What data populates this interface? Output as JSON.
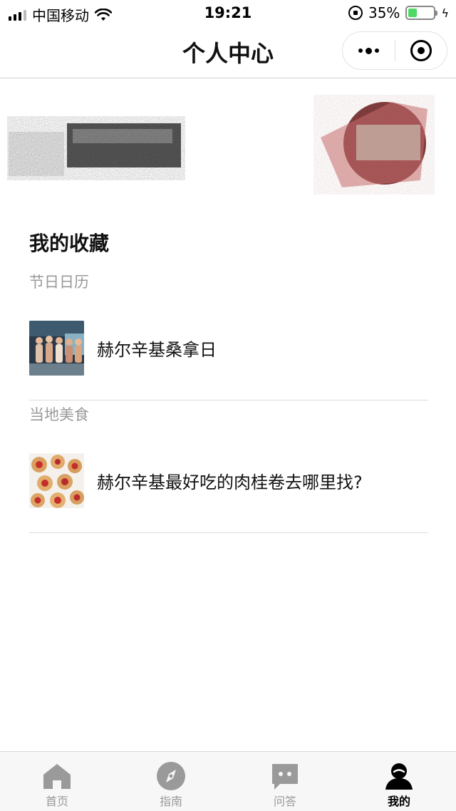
{
  "status_bar": {
    "carrier": "中国移动",
    "time": "19:21",
    "battery_percent": "35%",
    "battery_level": 0.35,
    "battery_color": "#4cd964",
    "icons": [
      "signal-icon",
      "wifi-icon",
      "orientation-lock-icon",
      "battery-icon",
      "charging-icon"
    ]
  },
  "nav": {
    "title": "个人中心",
    "more_icon": "more-dots-icon",
    "close_icon": "target-circle-icon"
  },
  "profile": {
    "name_redacted": true,
    "avatar_redacted": true
  },
  "favorites": {
    "title": "我的收藏",
    "groups": [
      {
        "label": "节日日历",
        "items": [
          {
            "text": "赫尔辛基桑拿日",
            "thumb": "sauna-photo"
          }
        ]
      },
      {
        "label": "当地美食",
        "items": [
          {
            "text": "赫尔辛基最好吃的肉桂卷去哪里找?",
            "thumb": "pastry-photo"
          }
        ]
      }
    ]
  },
  "tabbar": {
    "active_color": "#000000",
    "inactive_color": "#999999",
    "tabs": [
      {
        "label": "首页",
        "icon": "home-icon",
        "active": false
      },
      {
        "label": "指南",
        "icon": "compass-icon",
        "active": false
      },
      {
        "label": "问答",
        "icon": "chat-icon",
        "active": false
      },
      {
        "label": "我的",
        "icon": "user-icon",
        "active": true
      }
    ]
  }
}
